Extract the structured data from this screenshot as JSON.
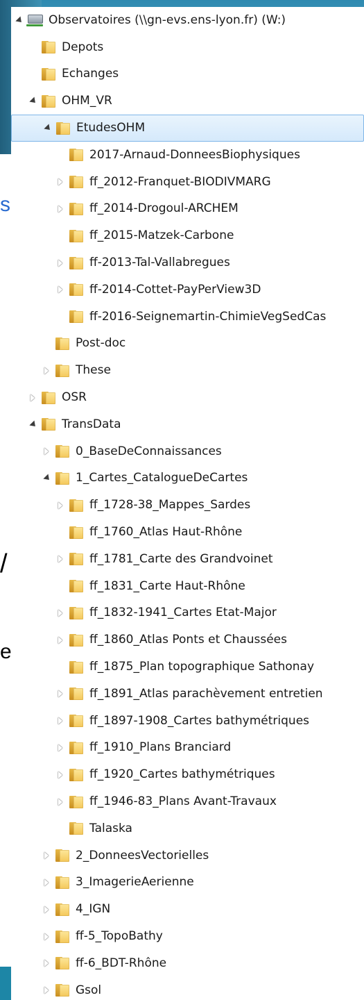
{
  "slide_fragments": [
    "s",
    "/",
    "eur"
  ],
  "tree": [
    {
      "label": "Observatoires (\\\\gn-evs.ens-lyon.fr) (W:)",
      "level": 0,
      "state": "expanded",
      "icon": "network-drive-icon",
      "selected": false
    },
    {
      "label": "Depots",
      "level": 1,
      "state": "none",
      "icon": "folder-icon",
      "selected": false
    },
    {
      "label": "Echanges",
      "level": 1,
      "state": "none",
      "icon": "folder-icon",
      "selected": false
    },
    {
      "label": "OHM_VR",
      "level": 1,
      "state": "expanded",
      "icon": "folder-icon",
      "selected": false
    },
    {
      "label": "EtudesOHM",
      "level": 2,
      "state": "expanded",
      "icon": "folder-icon",
      "selected": true
    },
    {
      "label": "2017-Arnaud-DonneesBiophysiques",
      "level": 3,
      "state": "none",
      "icon": "folder-icon",
      "selected": false
    },
    {
      "label": "ff_2012-Franquet-BIODIVMARG",
      "level": 3,
      "state": "collapsed",
      "icon": "folder-icon",
      "selected": false
    },
    {
      "label": "ff_2014-Drogoul-ARCHEM",
      "level": 3,
      "state": "collapsed",
      "icon": "folder-icon",
      "selected": false
    },
    {
      "label": "ff_2015-Matzek-Carbone",
      "level": 3,
      "state": "none",
      "icon": "folder-icon",
      "selected": false
    },
    {
      "label": "ff-2013-Tal-Vallabregues",
      "level": 3,
      "state": "collapsed",
      "icon": "folder-icon",
      "selected": false
    },
    {
      "label": "ff-2014-Cottet-PayPerView3D",
      "level": 3,
      "state": "collapsed",
      "icon": "folder-icon",
      "selected": false
    },
    {
      "label": "ff-2016-Seignemartin-ChimieVegSedCas",
      "level": 3,
      "state": "none",
      "icon": "folder-icon",
      "selected": false
    },
    {
      "label": "Post-doc",
      "level": 2,
      "state": "none",
      "icon": "folder-icon",
      "selected": false
    },
    {
      "label": "These",
      "level": 2,
      "state": "collapsed",
      "icon": "folder-icon",
      "selected": false
    },
    {
      "label": "OSR",
      "level": 1,
      "state": "collapsed",
      "icon": "folder-icon",
      "selected": false
    },
    {
      "label": "TransData",
      "level": 1,
      "state": "expanded",
      "icon": "folder-icon",
      "selected": false
    },
    {
      "label": "0_BaseDeConnaissances",
      "level": 2,
      "state": "collapsed",
      "icon": "folder-icon",
      "selected": false
    },
    {
      "label": "1_Cartes_CatalogueDeCartes",
      "level": 2,
      "state": "expanded",
      "icon": "folder-icon",
      "selected": false
    },
    {
      "label": "ff_1728-38_Mappes_Sardes",
      "level": 3,
      "state": "collapsed",
      "icon": "folder-icon",
      "selected": false
    },
    {
      "label": "ff_1760_Atlas Haut-Rhône",
      "level": 3,
      "state": "none",
      "icon": "folder-icon",
      "selected": false
    },
    {
      "label": "ff_1781_Carte des Grandvoinet",
      "level": 3,
      "state": "collapsed",
      "icon": "folder-icon",
      "selected": false
    },
    {
      "label": "ff_1831_Carte Haut-Rhône",
      "level": 3,
      "state": "none",
      "icon": "folder-icon",
      "selected": false
    },
    {
      "label": "ff_1832-1941_Cartes Etat-Major",
      "level": 3,
      "state": "collapsed",
      "icon": "folder-icon",
      "selected": false
    },
    {
      "label": "ff_1860_Atlas Ponts et Chaussées",
      "level": 3,
      "state": "collapsed",
      "icon": "folder-icon",
      "selected": false
    },
    {
      "label": "ff_1875_Plan topographique Sathonay",
      "level": 3,
      "state": "none",
      "icon": "folder-icon",
      "selected": false
    },
    {
      "label": "ff_1891_Atlas parachèvement entretien",
      "level": 3,
      "state": "collapsed",
      "icon": "folder-icon",
      "selected": false
    },
    {
      "label": "ff_1897-1908_Cartes bathymétriques",
      "level": 3,
      "state": "collapsed",
      "icon": "folder-icon",
      "selected": false
    },
    {
      "label": "ff_1910_Plans Branciard",
      "level": 3,
      "state": "collapsed",
      "icon": "folder-icon",
      "selected": false
    },
    {
      "label": "ff_1920_Cartes bathymétriques",
      "level": 3,
      "state": "collapsed",
      "icon": "folder-icon",
      "selected": false
    },
    {
      "label": "ff_1946-83_Plans Avant-Travaux",
      "level": 3,
      "state": "collapsed",
      "icon": "folder-icon",
      "selected": false
    },
    {
      "label": "Talaska",
      "level": 3,
      "state": "none",
      "icon": "folder-icon",
      "selected": false
    },
    {
      "label": "2_DonneesVectorielles",
      "level": 2,
      "state": "collapsed",
      "icon": "folder-icon",
      "selected": false
    },
    {
      "label": "3_ImagerieAerienne",
      "level": 2,
      "state": "collapsed",
      "icon": "folder-icon",
      "selected": false
    },
    {
      "label": "4_IGN",
      "level": 2,
      "state": "collapsed",
      "icon": "folder-icon",
      "selected": false
    },
    {
      "label": "ff-5_TopoBathy",
      "level": 2,
      "state": "collapsed",
      "icon": "folder-icon",
      "selected": false
    },
    {
      "label": "ff-6_BDT-Rhône",
      "level": 2,
      "state": "collapsed",
      "icon": "folder-icon",
      "selected": false
    },
    {
      "label": "Gsol",
      "level": 2,
      "state": "collapsed",
      "icon": "folder-icon",
      "selected": false
    }
  ]
}
